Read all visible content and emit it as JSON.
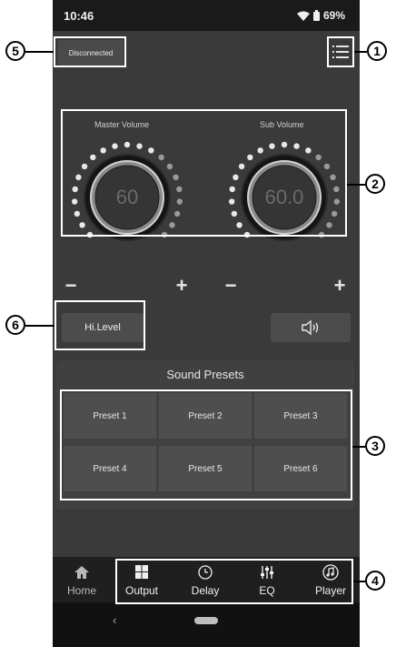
{
  "status_bar": {
    "time": "10:46",
    "battery": "69%"
  },
  "header": {
    "connection_label": "Disconnected",
    "menu_icon": "menu-list-icon"
  },
  "master_volume": {
    "label": "Master Volume",
    "value": "60",
    "level": 0.6
  },
  "sub_volume": {
    "label": "Sub Volume",
    "value": "60.0",
    "level": 0.6
  },
  "controls": {
    "minus": "−",
    "plus": "+",
    "level_button": "Hi.Level",
    "speaker_icon": "speaker-icon"
  },
  "presets": {
    "title": "Sound Presets",
    "items": [
      "Preset 1",
      "Preset 2",
      "Preset 3",
      "Preset 4",
      "Preset 5",
      "Preset 6"
    ]
  },
  "nav": {
    "items": [
      {
        "label": "Home",
        "icon": "home-icon"
      },
      {
        "label": "Output",
        "icon": "grid-icon"
      },
      {
        "label": "Delay",
        "icon": "clock-icon"
      },
      {
        "label": "EQ",
        "icon": "sliders-icon"
      },
      {
        "label": "Player",
        "icon": "music-note-icon"
      }
    ]
  },
  "system_nav": {
    "back": "‹"
  },
  "callouts": [
    "1",
    "2",
    "3",
    "4",
    "5",
    "6"
  ],
  "colors": {
    "background": "#3a3a3a",
    "panel": "#404040",
    "button": "#4e4e4e",
    "highlight": "#ffffff"
  }
}
